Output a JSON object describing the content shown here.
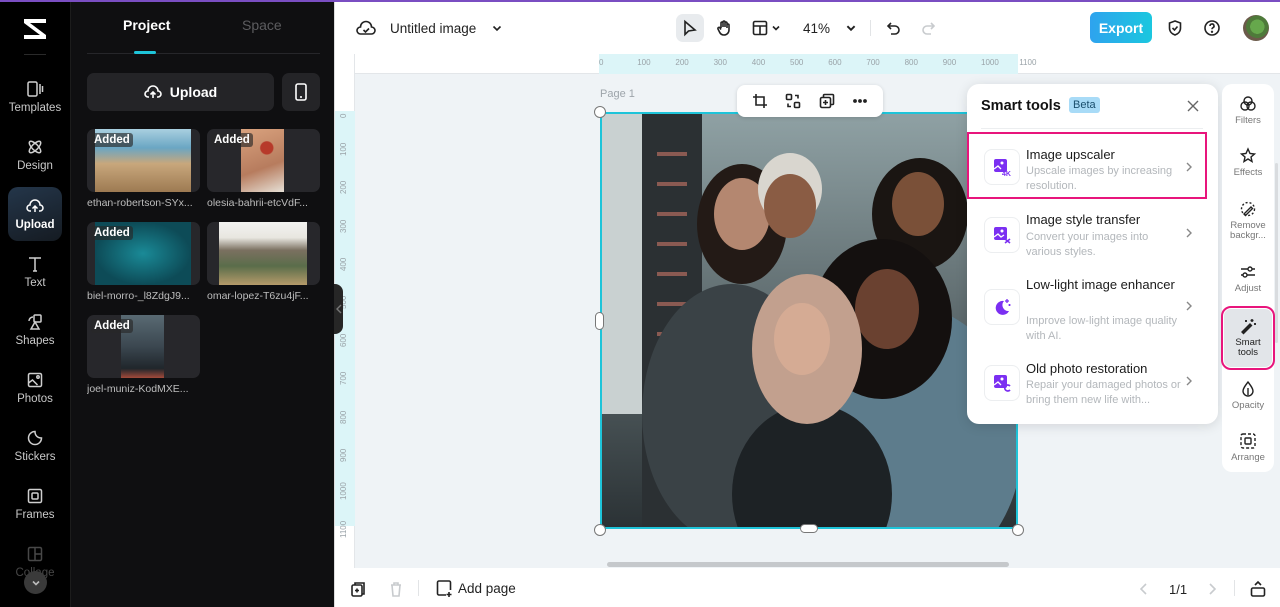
{
  "rail": {
    "items": [
      {
        "label": "Templates",
        "icon": "templates-icon"
      },
      {
        "label": "Design",
        "icon": "design-icon"
      },
      {
        "label": "Upload",
        "icon": "upload-cloud-icon",
        "active": true
      },
      {
        "label": "Text",
        "icon": "text-icon"
      },
      {
        "label": "Shapes",
        "icon": "shapes-icon"
      },
      {
        "label": "Photos",
        "icon": "photos-icon"
      },
      {
        "label": "Stickers",
        "icon": "stickers-icon"
      },
      {
        "label": "Frames",
        "icon": "frames-icon"
      },
      {
        "label": "Collage",
        "icon": "collage-icon"
      }
    ]
  },
  "panel": {
    "tabs": [
      {
        "label": "Project",
        "active": true
      },
      {
        "label": "Space",
        "active": false
      }
    ],
    "upload_label": "Upload",
    "uploads": [
      {
        "name": "ethan-robertson-SYx...",
        "badge": "Added"
      },
      {
        "name": "olesia-bahrii-etcVdF...",
        "badge": "Added"
      },
      {
        "name": "biel-morro-_l8ZdgJ9...",
        "badge": "Added"
      },
      {
        "name": "omar-lopez-T6zu4jF...",
        "badge": ""
      },
      {
        "name": "joel-muniz-KodMXE...",
        "badge": "Added"
      }
    ]
  },
  "topbar": {
    "title": "Untitled image",
    "zoom": "41%",
    "export_label": "Export"
  },
  "canvas": {
    "page_label": "Page 1",
    "h_ruler": [
      "0",
      "100",
      "200",
      "300",
      "400",
      "500",
      "600",
      "700",
      "800",
      "900",
      "1000",
      "1100"
    ],
    "v_ruler": [
      "0",
      "100",
      "200",
      "300",
      "400",
      "500",
      "600",
      "700",
      "800",
      "900",
      "1000",
      "1100"
    ]
  },
  "smart_tools": {
    "title": "Smart tools",
    "badge": "Beta",
    "items": [
      {
        "name": "Image upscaler",
        "desc": "Upscale images by increasing resolution.",
        "icon": "image-upscaler-icon",
        "highlighted": true
      },
      {
        "name": "Image style transfer",
        "desc": "Convert your images into various styles.",
        "icon": "style-transfer-icon"
      },
      {
        "name": "Low-light image enhancer",
        "desc": "Improve low-light image quality with AI.",
        "icon": "low-light-moon-icon"
      },
      {
        "name": "Old photo restoration",
        "desc": "Repair your damaged photos or bring them new life with...",
        "icon": "photo-restoration-icon"
      }
    ]
  },
  "right_rail": {
    "items": [
      {
        "label": "Filters"
      },
      {
        "label": "Effects"
      },
      {
        "label": "Remove backgr..."
      },
      {
        "label": "Adjust"
      },
      {
        "label": "Smart tools",
        "selected": true
      },
      {
        "label": "Opacity"
      },
      {
        "label": "Arrange"
      }
    ]
  },
  "bottombar": {
    "add_page_label": "Add page",
    "page_indicator": "1/1"
  },
  "colors": {
    "accent": "#1ec4d9",
    "highlight": "#e8157c",
    "tool_icon": "#7b2ff2"
  }
}
